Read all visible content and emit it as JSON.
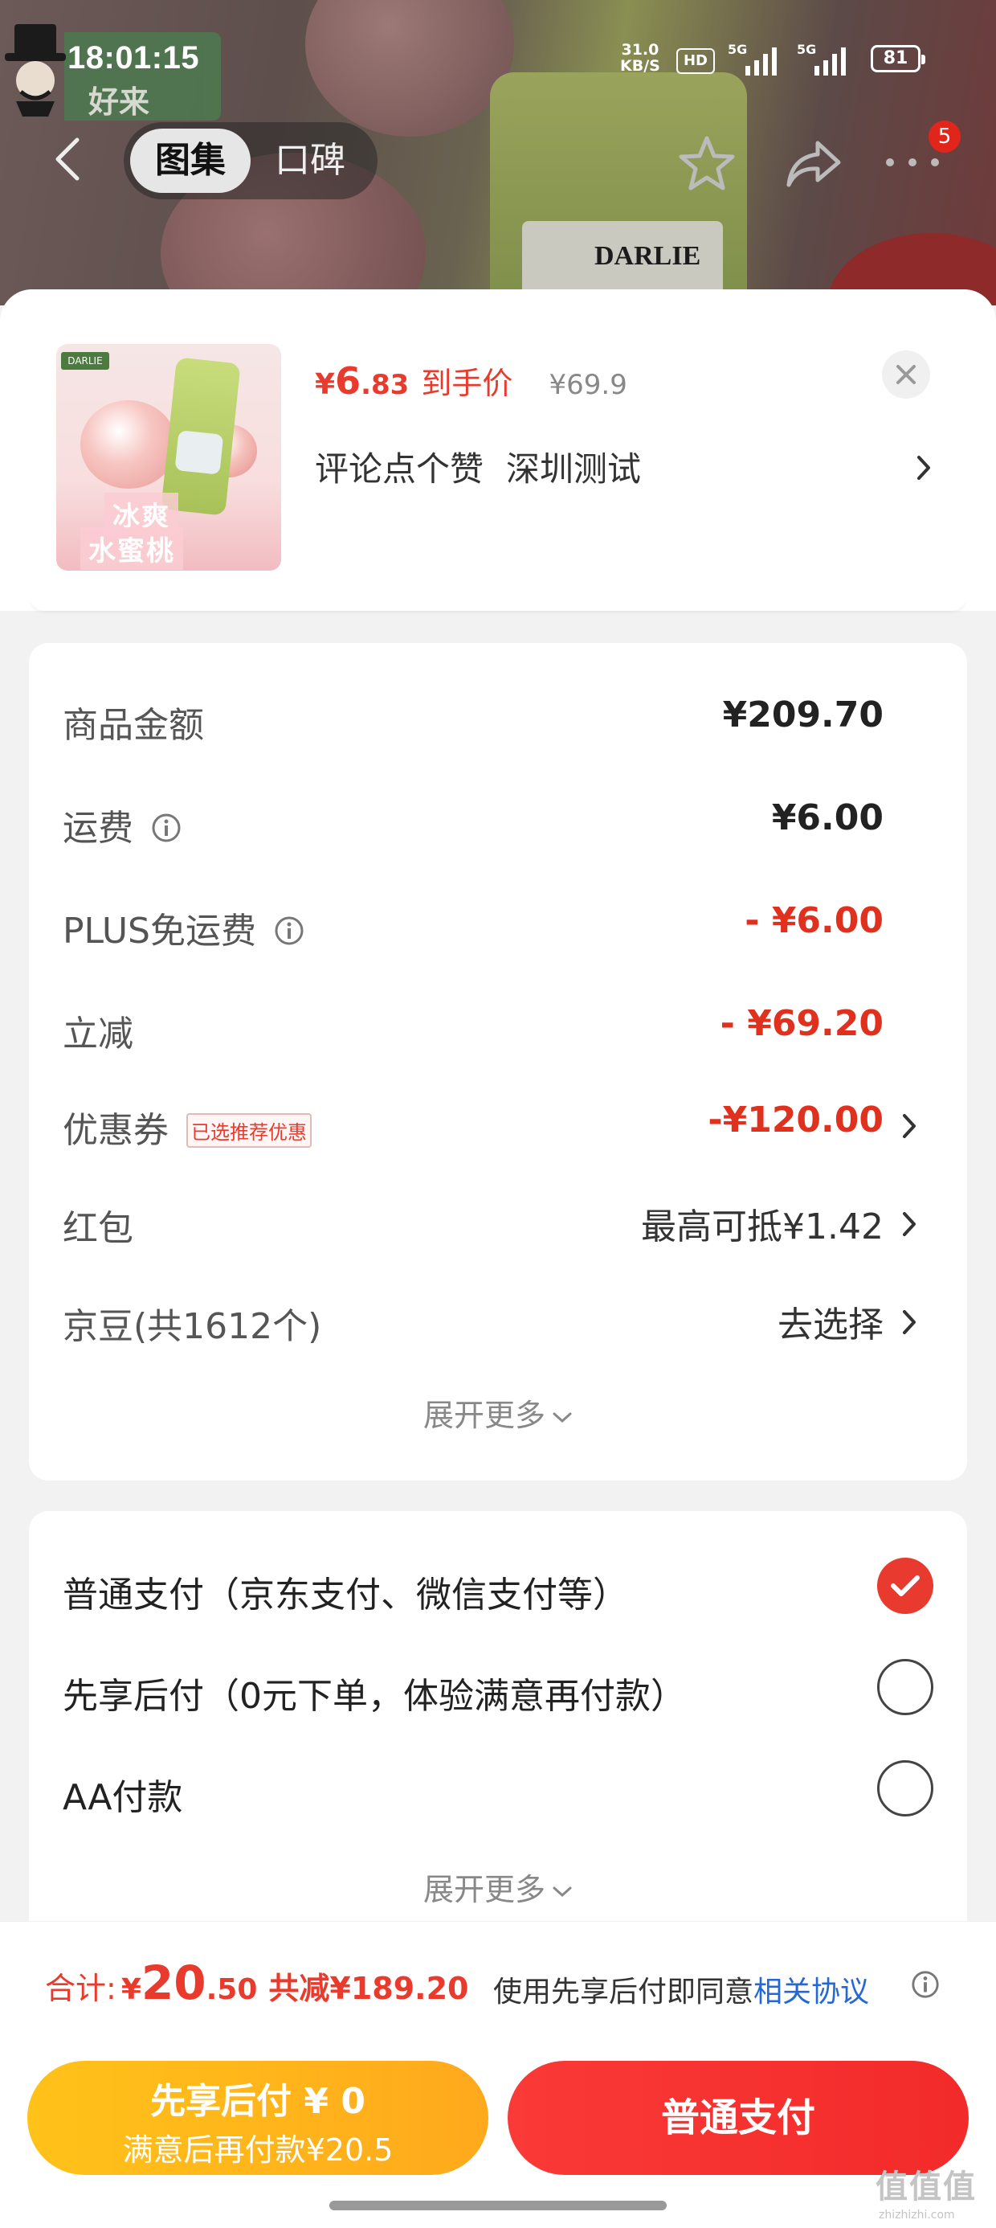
{
  "status_bar": {
    "time": "18:01:15",
    "net_speed_value": "31.0",
    "net_speed_unit": "KB/S",
    "hd_badge": "HD",
    "signal1_tag": "5G",
    "signal2_tag": "5G",
    "battery": "81"
  },
  "background": {
    "brand_text": "DARLIE",
    "corner_text": "好来"
  },
  "top_nav": {
    "tab_active": "图集",
    "tab_inactive": "口碑",
    "more_badge": "5"
  },
  "product": {
    "price_currency": "¥",
    "price_integer": "6",
    "price_decimal": ".83",
    "price_label": "到手价",
    "original_price": "¥69.9",
    "promo_text_1": "评论点个赞",
    "promo_text_2": "深圳测试",
    "thumb_logo": "DARLIE",
    "thumb_caption_1": "冰爽",
    "thumb_caption_2": "水蜜桃"
  },
  "fees": {
    "rows": [
      {
        "label": "商品金额",
        "value": "¥209.70"
      },
      {
        "label": "运费",
        "value": "¥6.00"
      },
      {
        "label": "PLUS免运费",
        "value": "- ¥6.00"
      },
      {
        "label": "立减",
        "value": "- ¥69.20"
      },
      {
        "label": "优惠券",
        "tag": "已选推荐优惠",
        "value": "-¥120.00"
      },
      {
        "label": "红包",
        "value": "最高可抵¥1.42"
      },
      {
        "label": "京豆(共1612个)",
        "value": "去选择"
      }
    ],
    "expand_label": "展开更多"
  },
  "payment": {
    "options": [
      {
        "label": "普通支付（京东支付、微信支付等）",
        "checked": true
      },
      {
        "label": "先享后付（0元下单，体验满意再付款）",
        "checked": false
      },
      {
        "label": "AA付款",
        "checked": false
      }
    ],
    "expand_label": "展开更多"
  },
  "total": {
    "label": "合计:",
    "currency": "¥",
    "integer": "20",
    "decimal": ".50",
    "saved": "共减¥189.20",
    "agree_text": "使用先享后付即同意",
    "agree_link": "相关协议"
  },
  "buttons": {
    "later_line1": "先享后付 ¥ 0",
    "later_line2": "满意后再付款¥20.5",
    "pay": "普通支付"
  },
  "watermark": {
    "text": "值值值",
    "sub": "zhizhizhi.com"
  },
  "colors": {
    "accent_red": "#e93b2d",
    "link_blue": "#2667d8",
    "pay_red": "#f22a2a",
    "later_yellow": "#ffb31a"
  }
}
